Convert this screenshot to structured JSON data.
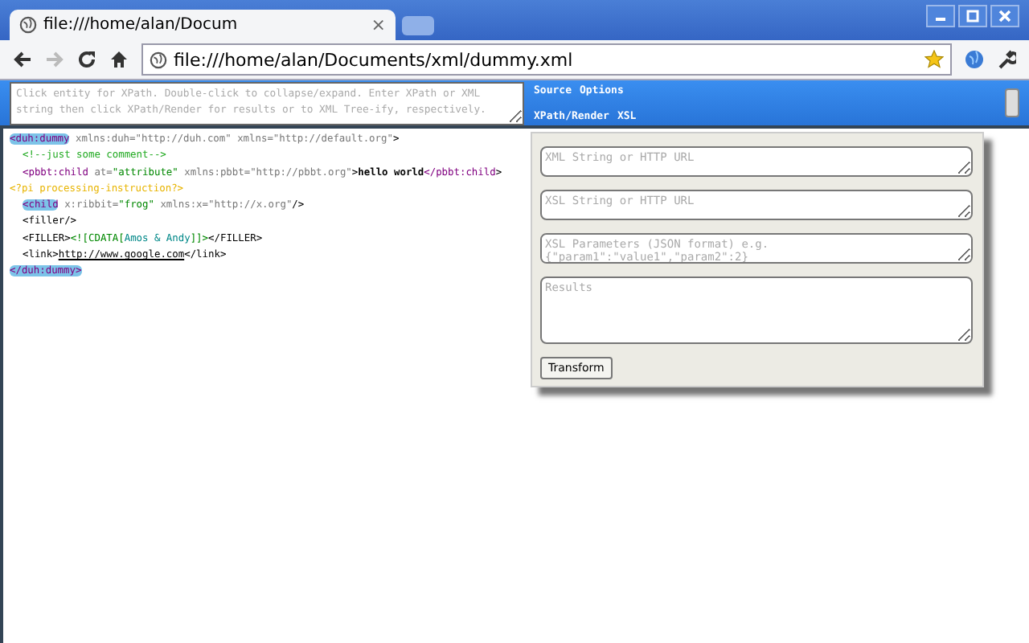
{
  "tab": {
    "title": "file:///home/alan/Docum",
    "close": "×"
  },
  "address": {
    "url": "file:///home/alan/Documents/xml/dummy.xml"
  },
  "xpath_bar": {
    "placeholder": "Click entity for XPath. Double-click to collapse/expand. Enter XPath or XML string then click XPath/Render for results or to XML Tree-ify, respectively.",
    "links": [
      "Source",
      "Options",
      "XPath/Render",
      "XSL"
    ]
  },
  "xml": [
    {
      "kind": "element",
      "tokens": [
        {
          "kind": "tag",
          "text": "<duh:dummy",
          "highlighted": true
        },
        {
          "kind": "attr",
          "text": " xmlns:duh="
        },
        {
          "kind": "attr",
          "text": "\"http://duh.com\""
        },
        {
          "kind": "attr",
          "text": " xmlns=\"http://default.org\""
        },
        {
          "kind": "bracket",
          "text": ">"
        }
      ],
      "children": [
        {
          "kind": "element",
          "tokens": [
            {
              "kind": "comment",
              "text": "<!--just some comment-->"
            }
          ]
        },
        {
          "kind": "element",
          "tokens": [
            {
              "kind": "tag",
              "text": "<pbbt:child",
              "highlighted": false
            },
            {
              "kind": "attr",
              "text": " at="
            },
            {
              "kind": "value",
              "text": "\"attribute\""
            },
            {
              "kind": "attr",
              "text": " xmlns:pbbt=\"http://pbbt.org\""
            },
            {
              "kind": "bracket",
              "text": ">"
            },
            {
              "kind": "text",
              "text": "hello world"
            },
            {
              "kind": "tag",
              "text": "</pbbt:child",
              "highlighted": false
            },
            {
              "kind": "bracket",
              "text": ">"
            }
          ]
        },
        {
          "kind": "pi",
          "tokens": [
            {
              "kind": "pi",
              "text": "<?pi processing-instruction?>"
            }
          ]
        },
        {
          "kind": "element",
          "tokens": [
            {
              "kind": "tag",
              "text": "<child",
              "highlighted": true
            },
            {
              "kind": "attr",
              "text": " x:ribbit="
            },
            {
              "kind": "value",
              "text": "\"frog\""
            },
            {
              "kind": "attr",
              "text": " xmlns:x=\"http://x.org\""
            },
            {
              "kind": "bracket",
              "text": "/>"
            }
          ]
        },
        {
          "kind": "element",
          "tokens": [
            {
              "kind": "bracket",
              "text": "<filler/>"
            }
          ]
        },
        {
          "kind": "element",
          "tokens": [
            {
              "kind": "bracket",
              "text": "<FILLER>"
            },
            {
              "kind": "cdata",
              "text": "<![CDATA["
            },
            {
              "kind": "cdatatext",
              "text": "Amos & Andy"
            },
            {
              "kind": "cdata",
              "text": "]]>"
            },
            {
              "kind": "bracket",
              "text": "</FILLER>"
            }
          ]
        },
        {
          "kind": "element",
          "tokens": [
            {
              "kind": "bracket",
              "text": "<link>"
            },
            {
              "kind": "link",
              "text": "http://www.google.com"
            },
            {
              "kind": "bracket",
              "text": "</link>"
            }
          ]
        }
      ],
      "close": [
        {
          "kind": "tag",
          "text": "</duh:dummy>",
          "highlighted": true
        }
      ]
    }
  ],
  "panel": {
    "fields": [
      {
        "placeholder": "XML String or HTTP URL"
      },
      {
        "placeholder": "XSL String or HTTP URL"
      },
      {
        "placeholder": "XSL Parameters (JSON format) e.g.{\"param1\":\"value1\",\"param2\":2}"
      },
      {
        "placeholder": "Results",
        "kind": "tall"
      }
    ],
    "button": "Transform"
  }
}
